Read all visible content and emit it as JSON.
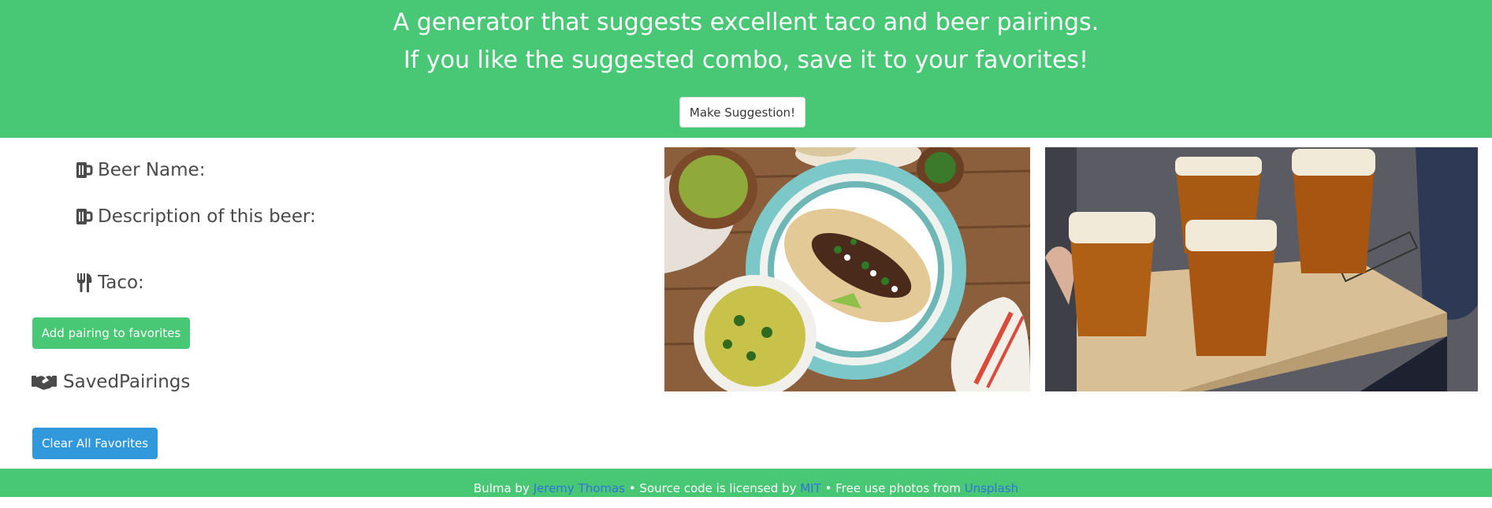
{
  "hero": {
    "line1": "A generator that suggests excellent taco and beer pairings.",
    "line2": "If you like the suggested combo, save it to your favorites!",
    "suggest_button": "Make Suggestion!",
    "bg_color": "#48c774"
  },
  "details": {
    "beer_name_label": "Beer Name:",
    "beer_description_label": "Description of this beer:",
    "taco_label": "Taco:",
    "beer_icon": "beer-mug-icon",
    "taco_icon": "utensils-icon"
  },
  "actions": {
    "add_favorite": "Add pairing to favorites",
    "clear_favorites": "Clear All Favorites"
  },
  "saved": {
    "heading": "SavedPairings",
    "icon": "handshake-icon"
  },
  "images": {
    "taco": "taco-photo",
    "beer": "beer-photo"
  },
  "footer": {
    "prefix": "Bulma by ",
    "author": "Jeremy Thomas",
    "mid": " • Source code is licensed by ",
    "license": "MIT",
    "mid2": " • Free use photos from ",
    "photos": "Unsplash",
    "link_color": "#3273dc"
  }
}
